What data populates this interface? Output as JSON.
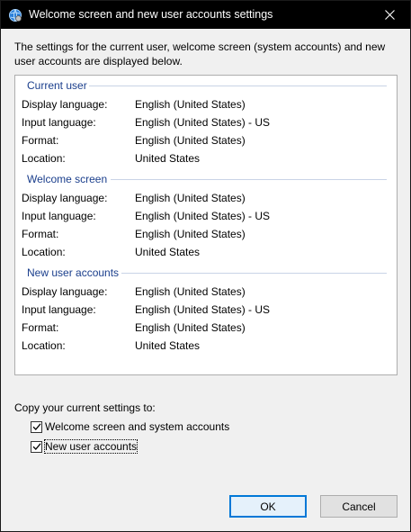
{
  "window": {
    "title": "Welcome screen and new user accounts settings",
    "description": "The settings for the current user, welcome screen (system accounts) and new user accounts are displayed below."
  },
  "sections": [
    {
      "title": "Current user",
      "rows": [
        {
          "label": "Display language:",
          "value": "English (United States)"
        },
        {
          "label": "Input language:",
          "value": "English (United States) - US"
        },
        {
          "label": "Format:",
          "value": "English (United States)"
        },
        {
          "label": "Location:",
          "value": "United States"
        }
      ]
    },
    {
      "title": "Welcome screen",
      "rows": [
        {
          "label": "Display language:",
          "value": "English (United States)"
        },
        {
          "label": "Input language:",
          "value": "English (United States) - US"
        },
        {
          "label": "Format:",
          "value": "English (United States)"
        },
        {
          "label": "Location:",
          "value": "United States"
        }
      ]
    },
    {
      "title": "New user accounts",
      "rows": [
        {
          "label": "Display language:",
          "value": "English (United States)"
        },
        {
          "label": "Input language:",
          "value": "English (United States) - US"
        },
        {
          "label": "Format:",
          "value": "English (United States)"
        },
        {
          "label": "Location:",
          "value": "United States"
        }
      ]
    }
  ],
  "copy": {
    "label": "Copy your current settings to:",
    "options": [
      {
        "label": "Welcome screen and system accounts",
        "checked": true
      },
      {
        "label": "New user accounts",
        "checked": true
      }
    ]
  },
  "buttons": {
    "ok": "OK",
    "cancel": "Cancel"
  },
  "colors": {
    "section_title": "#1a3e8c",
    "titlebar": "#000000",
    "default_button_border": "#0078d7"
  },
  "icons": {
    "app": "globe-settings-icon",
    "close": "close-icon",
    "check": "checkmark-icon"
  }
}
